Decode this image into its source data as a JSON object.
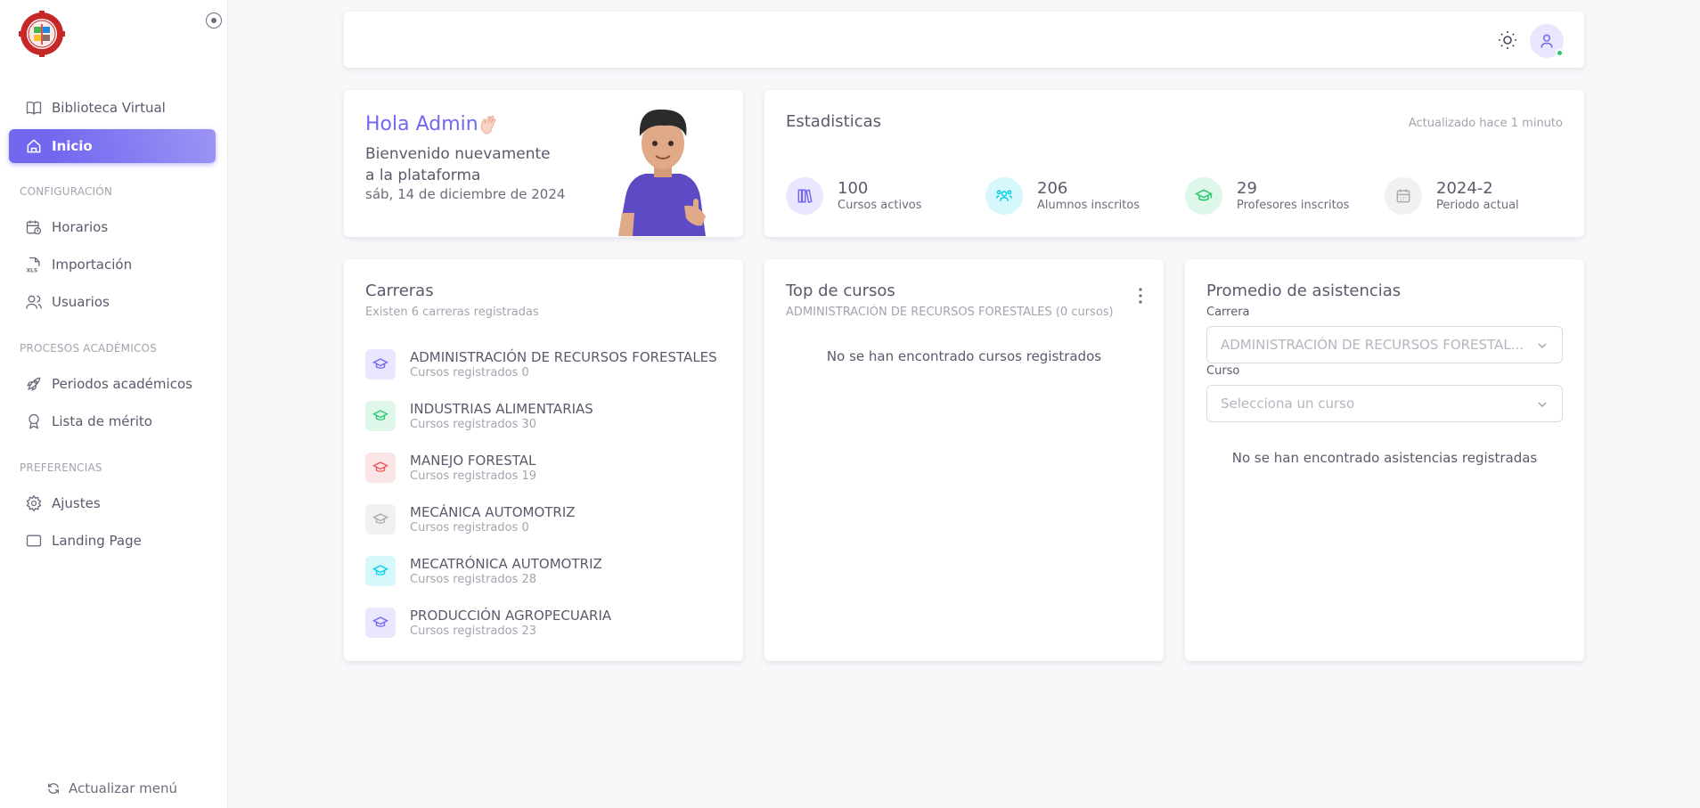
{
  "sidebar": {
    "items": {
      "biblioteca": "Biblioteca Virtual",
      "inicio": "Inicio",
      "horarios": "Horarios",
      "importacion": "Importación",
      "usuarios": "Usuarios",
      "periodos": "Periodos académicos",
      "merito": "Lista de mérito",
      "ajustes": "Ajustes",
      "landing": "Landing Page"
    },
    "sections": {
      "config": "CONFIGURACIÓN",
      "procesos": "PROCESOS ACADÉMICOS",
      "preferencias": "PREFERENCIAS"
    },
    "refresh_label": "Actualizar menú"
  },
  "welcome": {
    "title": "Hola Admin",
    "subtitle": "Bienvenido nuevamente a la plataforma",
    "date": "sáb, 14 de diciembre de 2024"
  },
  "stats": {
    "title": "Estadisticas",
    "updated": "Actualizado hace 1 minuto",
    "items": [
      {
        "value": "100",
        "label": "Cursos activos",
        "icon": "books-icon",
        "color": "#7367f0"
      },
      {
        "value": "206",
        "label": "Alumnos inscritos",
        "icon": "users-icon",
        "color": "#00cfe8"
      },
      {
        "value": "29",
        "label": "Profesores inscritos",
        "icon": "graduation-cap-icon",
        "color": "#28c76f"
      },
      {
        "value": "2024-2",
        "label": "Periodo actual",
        "icon": "calendar-icon",
        "color": "#a8aaae"
      }
    ]
  },
  "careers": {
    "title": "Carreras",
    "subtitle": "Existen 6 carreras registradas",
    "items": [
      {
        "name": "ADMINISTRACIÓN DE RECURSOS FORESTALES",
        "count": "Cursos registrados 0",
        "color": "#7367f0"
      },
      {
        "name": "INDUSTRIAS ALIMENTARIAS",
        "count": "Cursos registrados 30",
        "color": "#28c76f"
      },
      {
        "name": "MANEJO FORESTAL",
        "count": "Cursos registrados 19",
        "color": "#ea5455"
      },
      {
        "name": "MECÁNICA AUTOMOTRIZ",
        "count": "Cursos registrados 0",
        "color": "#a8aaae"
      },
      {
        "name": "MECATRÓNICA AUTOMOTRIZ",
        "count": "Cursos registrados 28",
        "color": "#00cfe8"
      },
      {
        "name": "PRODUCCIÓN AGROPECUARIA",
        "count": "Cursos registrados 23",
        "color": "#7367f0"
      }
    ]
  },
  "top_courses": {
    "title": "Top de cursos",
    "subtitle": "ADMINISTRACIÓN DE RECURSOS FORESTALES (0 cursos)",
    "empty": "No se han encontrado cursos registrados"
  },
  "attendance": {
    "title": "Promedio de asistencias",
    "career_label": "Carrera",
    "career_value": "ADMINISTRACIÓN DE RECURSOS FORESTAL...",
    "course_label": "Curso",
    "course_placeholder": "Selecciona un curso",
    "empty": "No se han encontrado asistencias registradas"
  },
  "colors": {
    "accent": "#7367f0",
    "online": "#28c76f"
  }
}
